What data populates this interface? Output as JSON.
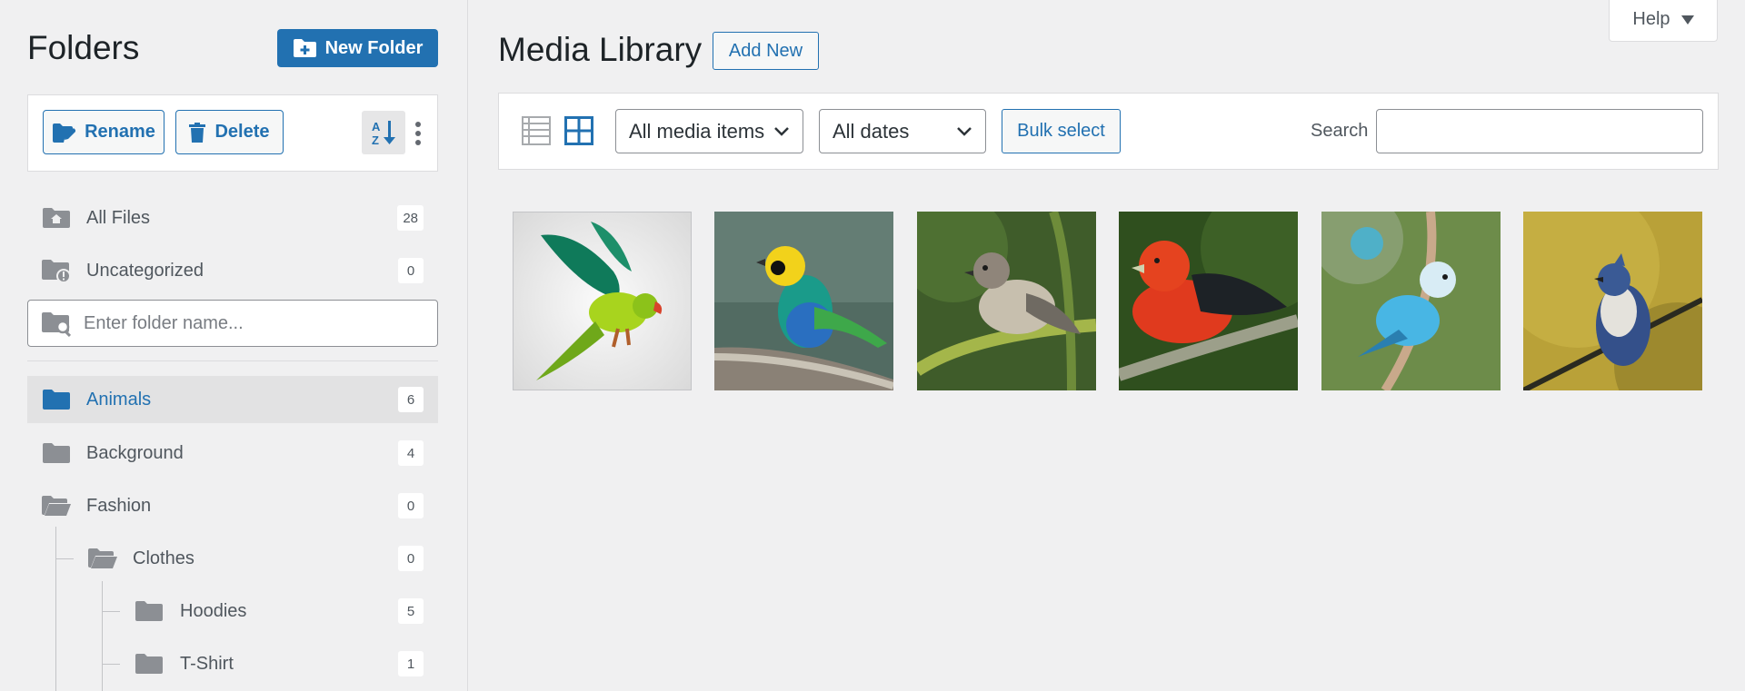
{
  "sidebar": {
    "title": "Folders",
    "new_folder_label": "New Folder",
    "rename_label": "Rename",
    "delete_label": "Delete",
    "folder_search_placeholder": "Enter folder name...",
    "special_items": [
      {
        "label": "All Files",
        "count": "28"
      },
      {
        "label": "Uncategorized",
        "count": "0"
      }
    ],
    "folders": [
      {
        "label": "Animals",
        "count": "6",
        "active": true
      },
      {
        "label": "Background",
        "count": "4"
      },
      {
        "label": "Fashion",
        "count": "0",
        "open": true
      },
      {
        "label": "Clothes",
        "count": "0",
        "open": true
      },
      {
        "label": "Hoodies",
        "count": "5"
      },
      {
        "label": "T-Shirt",
        "count": "1"
      }
    ]
  },
  "header": {
    "title": "Media Library",
    "add_new_label": "Add New",
    "help_label": "Help"
  },
  "toolbar": {
    "media_type_selected": "All media items",
    "date_selected": "All dates",
    "bulk_select_label": "Bulk select",
    "search_label": "Search",
    "search_value": ""
  },
  "media": [
    {
      "icon": "green-parrot-image"
    },
    {
      "icon": "multicolored-tanager-image"
    },
    {
      "icon": "warbler-image"
    },
    {
      "icon": "scarlet-tanager-image"
    },
    {
      "icon": "blue-budgie-image"
    },
    {
      "icon": "blue-jay-image"
    }
  ],
  "colors": {
    "accent": "#2271b1",
    "background": "#f0f0f1",
    "icon_gray": "#8c8f94"
  }
}
